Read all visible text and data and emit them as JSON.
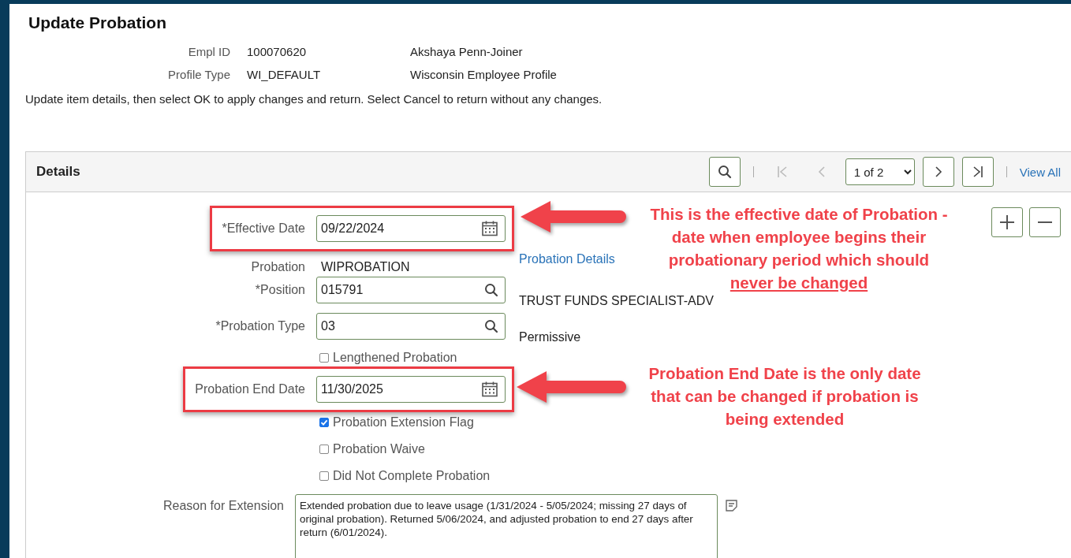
{
  "page": {
    "title": "Update Probation"
  },
  "header_fields": [
    {
      "label": "Empl ID",
      "value": "100070620",
      "description": "Akshaya Penn-Joiner"
    },
    {
      "label": "Profile Type",
      "value": "WI_DEFAULT",
      "description": "Wisconsin Employee Profile"
    }
  ],
  "instructions": "Update item details, then select OK to apply changes and return. Select Cancel to return without any changes.",
  "details": {
    "title": "Details",
    "page_select": "1 of 2",
    "view_all": "View All",
    "nav_buttons": [
      {
        "kind": "first",
        "disabled": true
      },
      {
        "kind": "prev",
        "disabled": true
      },
      {
        "kind": "next",
        "disabled": false
      },
      {
        "kind": "last",
        "disabled": false
      }
    ],
    "fields": [
      {
        "kind": "date",
        "label": "*Effective Date",
        "value": "09/22/2024",
        "highlighted": true
      },
      {
        "kind": "display",
        "label": "Probation",
        "value": "WIPROBATION",
        "aside": {
          "kind": "link",
          "text": "Probation Details"
        }
      },
      {
        "kind": "lookup",
        "label": "*Position",
        "value": "015791",
        "aside": {
          "kind": "text",
          "text": "TRUST FUNDS SPECIALIST-ADV"
        }
      },
      {
        "kind": "lookup",
        "label": "*Probation Type",
        "value": "03",
        "aside": {
          "kind": "text",
          "text": "Permissive"
        }
      },
      {
        "kind": "checkbox",
        "label": "Lengthened Probation",
        "checked": false
      },
      {
        "kind": "date",
        "label": "Probation End Date",
        "value": "11/30/2025",
        "highlighted": true
      },
      {
        "kind": "checkbox",
        "label": "Probation Extension Flag",
        "checked": true
      },
      {
        "kind": "checkbox",
        "label": "Probation Waive",
        "checked": false
      },
      {
        "kind": "checkbox",
        "label": "Did Not Complete Probation",
        "checked": false
      },
      {
        "kind": "textarea",
        "label": "Reason for Extension",
        "value": "Extended probation due to leave usage (1/31/2024 - 5/05/2024; missing 27 days of original probation). Returned 5/06/2024, and adjusted probation to end 27 days after return (6/01/2024)."
      }
    ]
  },
  "annotations": [
    {
      "lines": [
        {
          "text": "This is the effective date of Probation -",
          "underlined": false
        },
        {
          "text": "date when employee begins their",
          "underlined": false
        },
        {
          "text": "probationary period which should",
          "underlined": false
        },
        {
          "text": "never be changed",
          "underlined": true
        }
      ]
    },
    {
      "lines": [
        {
          "text": "Probation End Date is the only date",
          "underlined": false
        },
        {
          "text": "that can be changed if probation is",
          "underlined": false
        },
        {
          "text": "being extended",
          "underlined": false
        }
      ]
    }
  ]
}
